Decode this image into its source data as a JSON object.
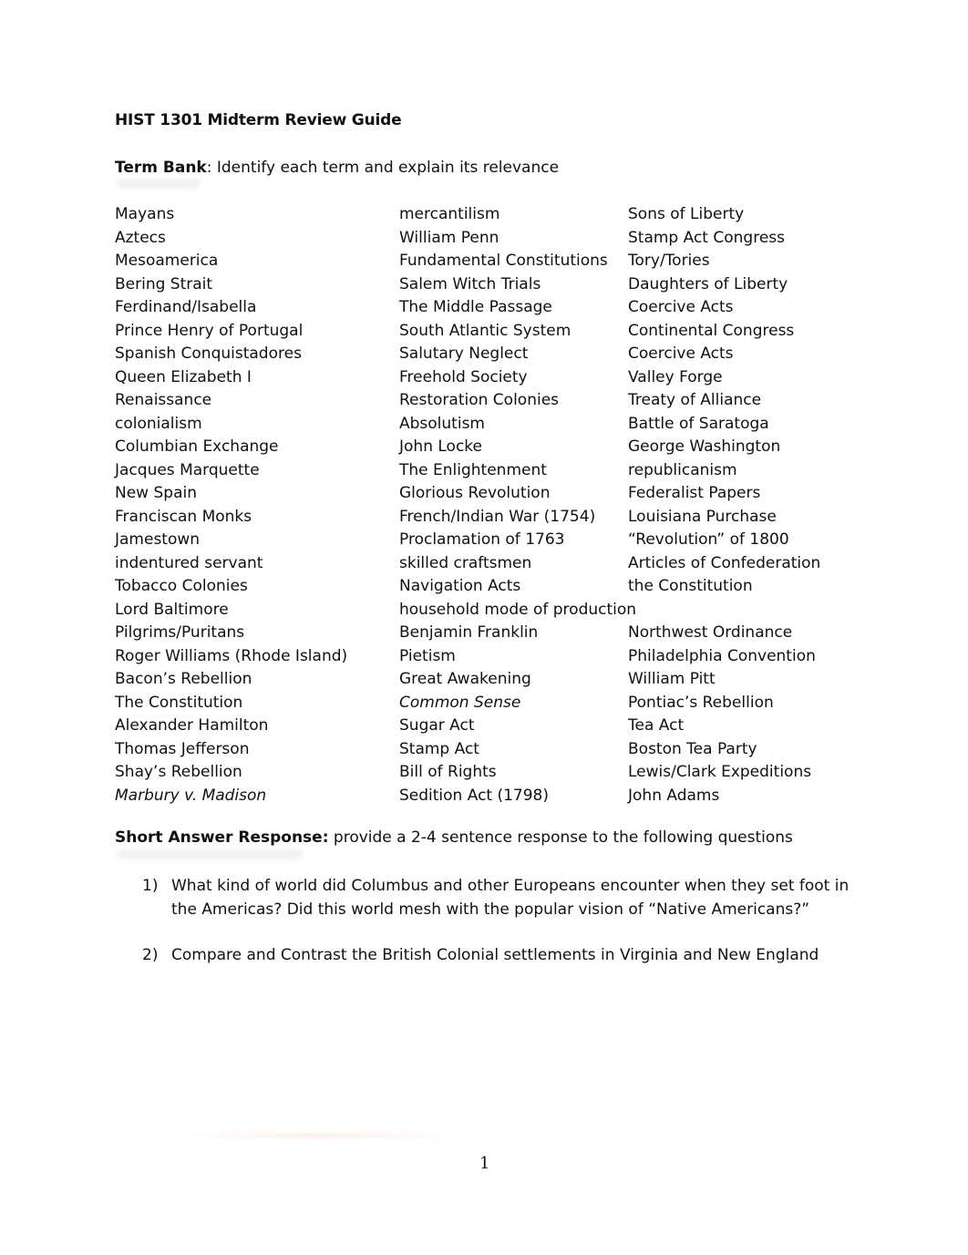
{
  "document": {
    "title": "HIST 1301 Midterm Review Guide",
    "term_bank": {
      "label": "Term Bank",
      "instruction": ": Identify each term and explain its relevance"
    },
    "columns": [
      [
        {
          "text": "Mayans"
        },
        {
          "text": "Aztecs"
        },
        {
          "text": "Mesoamerica"
        },
        {
          "text": "Bering Strait"
        },
        {
          "text": "Ferdinand/Isabella"
        },
        {
          "text": "Prince Henry of Portugal"
        },
        {
          "text": "Spanish Conquistadores"
        },
        {
          "text": "Queen Elizabeth I"
        },
        {
          "text": "Renaissance"
        },
        {
          "text": "colonialism"
        },
        {
          "text": "Columbian Exchange"
        },
        {
          "text": "Jacques Marquette"
        },
        {
          "text": "New Spain"
        },
        {
          "text": "Franciscan Monks"
        },
        {
          "text": "Jamestown"
        },
        {
          "text": "indentured servant"
        },
        {
          "text": "Tobacco Colonies"
        },
        {
          "text": "Lord Baltimore"
        },
        {
          "text": "Pilgrims/Puritans"
        },
        {
          "text": "Roger Williams (Rhode Island)"
        },
        {
          "text": "Bacon’s Rebellion"
        },
        {
          "text": "The Constitution"
        },
        {
          "text": "Alexander Hamilton"
        },
        {
          "text": "Thomas Jefferson"
        },
        {
          "text": "Shay’s Rebellion"
        },
        {
          "text": "Marbury v. Madison",
          "italic": true
        }
      ],
      [
        {
          "text": "mercantilism"
        },
        {
          "text": "William Penn"
        },
        {
          "text": "Fundamental Constitutions"
        },
        {
          "text": "Salem Witch Trials"
        },
        {
          "text": "The Middle Passage"
        },
        {
          "text": "South Atlantic System"
        },
        {
          "text": "Salutary Neglect"
        },
        {
          "text": "Freehold Society"
        },
        {
          "text": "Restoration Colonies"
        },
        {
          "text": "Absolutism"
        },
        {
          "text": "John Locke"
        },
        {
          "text": "The Enlightenment"
        },
        {
          "text": "Glorious Revolution"
        },
        {
          "text": "French/Indian War (1754)"
        },
        {
          "text": "Proclamation of 1763"
        },
        {
          "text": "skilled craftsmen"
        },
        {
          "text": "Navigation Acts"
        },
        {
          "text": "household mode of production"
        },
        {
          "text": "Benjamin Franklin"
        },
        {
          "text": "Pietism"
        },
        {
          "text": "Great Awakening"
        },
        {
          "text": "Common Sense",
          "italic": true
        },
        {
          "text": "Sugar Act"
        },
        {
          "text": "Stamp Act"
        },
        {
          "text": "Bill of Rights"
        },
        {
          "text": "Sedition Act (1798)"
        }
      ],
      [
        {
          "text": "Sons of Liberty"
        },
        {
          "text": "Stamp Act Congress"
        },
        {
          "text": "Tory/Tories"
        },
        {
          "text": "Daughters of Liberty"
        },
        {
          "text": "Coercive Acts"
        },
        {
          "text": "Continental Congress"
        },
        {
          "text": "Coercive Acts"
        },
        {
          "text": "Valley Forge"
        },
        {
          "text": "Treaty of Alliance"
        },
        {
          "text": "Battle of Saratoga"
        },
        {
          "text": "George Washington"
        },
        {
          "text": "republicanism"
        },
        {
          "text": "Federalist Papers"
        },
        {
          "text": "Louisiana Purchase"
        },
        {
          "text": "“Revolution” of 1800"
        },
        {
          "text": "Articles of Confederation"
        },
        {
          "text": "the Constitution"
        },
        {
          "text": ""
        },
        {
          "text": "Northwest Ordinance"
        },
        {
          "text": "Philadelphia Convention"
        },
        {
          "text": "William Pitt"
        },
        {
          "text": "Pontiac’s Rebellion"
        },
        {
          "text": "Tea Act"
        },
        {
          "text": "Boston Tea Party"
        },
        {
          "text": "Lewis/Clark Expeditions"
        },
        {
          "text": "John Adams"
        }
      ]
    ],
    "short_answer": {
      "label": "Short Answer Response:",
      "instruction": " provide a 2-4 sentence response to the following questions",
      "questions": [
        {
          "number": "1)",
          "text": "What kind of world did Columbus and other Europeans encounter when they set foot in the Americas?  Did this world mesh with the popular vision of “Native Americans?”"
        },
        {
          "number": "2)",
          "text": "Compare and Contrast the British Colonial settlements in Virginia and New England"
        }
      ]
    },
    "page_number": "1"
  }
}
